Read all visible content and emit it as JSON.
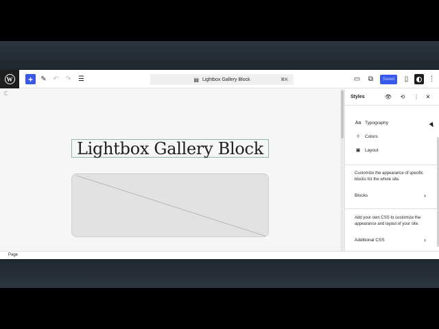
{
  "toolbar": {
    "logo": "W",
    "add_label": "+",
    "tools_icon": "✎",
    "undo_icon": "↶",
    "redo_icon": "↷",
    "list_view_icon": "☰",
    "document_title": "Lightbox Gallery Block",
    "shortcut": "⌘K",
    "desktop_icon": "▭",
    "external_icon": "⧉",
    "saved_label": "Saved",
    "sidebar_icon": "▯",
    "more_icon": "⋮"
  },
  "canvas": {
    "heading": "Lightbox Gallery Block"
  },
  "footer": {
    "breadcrumb": "Page"
  },
  "sidebar": {
    "title": "Styles",
    "items": [
      {
        "icon": "Aa",
        "label": "Typography"
      },
      {
        "icon": "◊",
        "label": "Colors"
      },
      {
        "icon": "▣",
        "label": "Layout"
      }
    ],
    "blocks_desc": "Customize the appearance of specific blocks for the whole site.",
    "blocks_label": "Blocks",
    "css_desc": "Add your own CSS to customize the appearance and layout of your site.",
    "css_label": "Additional CSS",
    "chevron": "›"
  },
  "colors": {
    "accent": "#3858e9",
    "dark": "#1e1e1e",
    "band": "#2c3640"
  }
}
